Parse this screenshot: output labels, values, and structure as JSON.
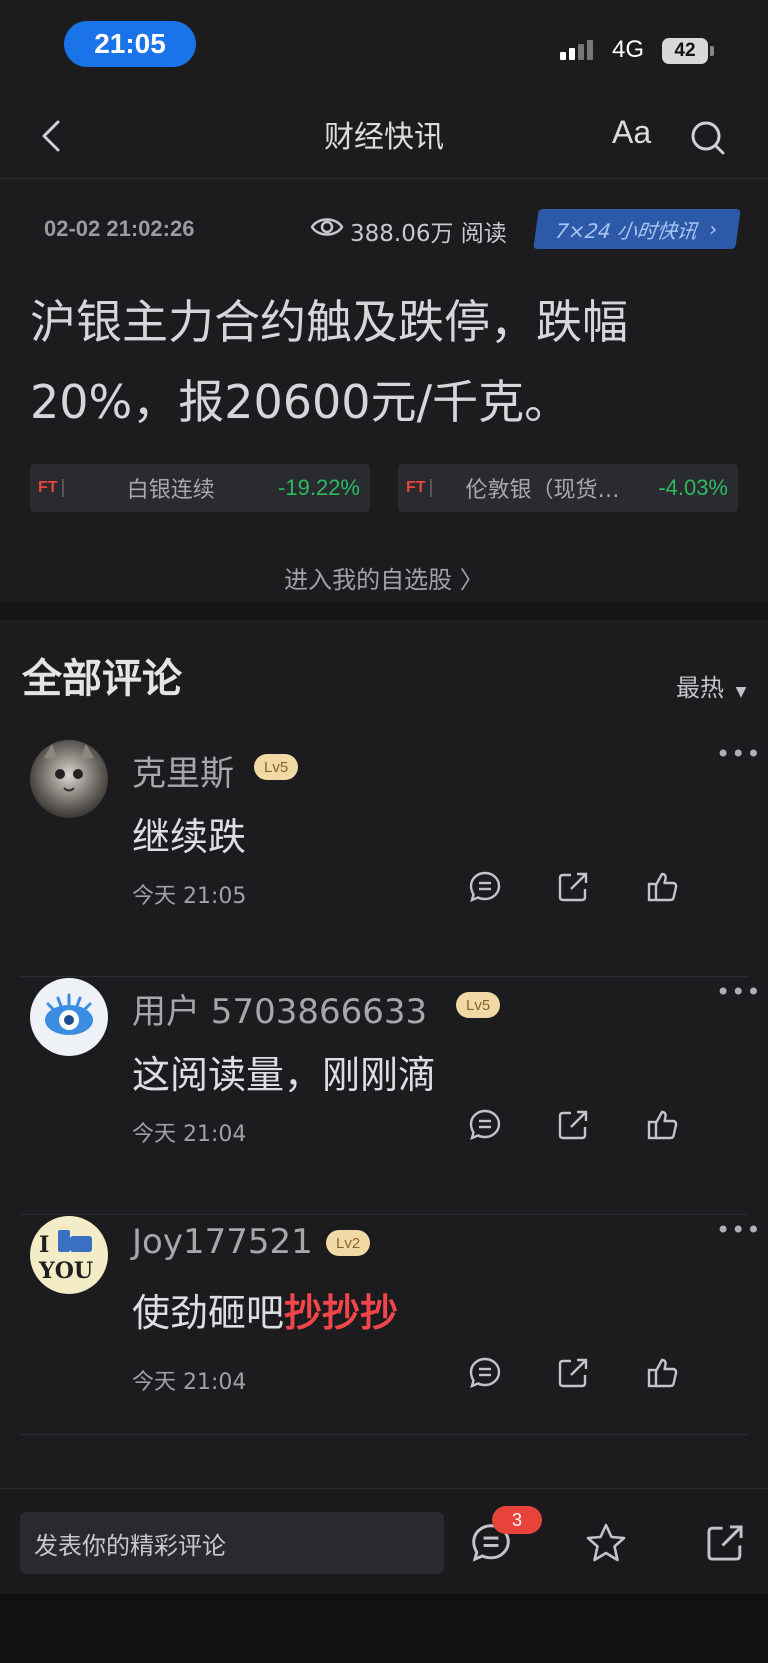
{
  "status_bar": {
    "time": "21:05",
    "network": "4G",
    "battery": "42"
  },
  "nav": {
    "title": "财经快讯",
    "font_label": "Aa"
  },
  "news": {
    "datetime": "02-02 21:02:26",
    "views": "388.06万 阅读",
    "tag": "7×24 小时快讯",
    "headline": "沪银主力合约触及跌停，跌幅20%，报20600元/千克。",
    "stocks": [
      {
        "badge": "FT",
        "name": "白银连续",
        "change": "-19.22%"
      },
      {
        "badge": "FT",
        "name": "伦敦银（现货…",
        "change": "-4.03%"
      }
    ],
    "watchlist_link": "进入我的自选股 〉"
  },
  "comments_section": {
    "title": "全部评论",
    "sort": "最热",
    "items": [
      {
        "user": "克里斯",
        "level": "Lv5",
        "text": "继续跌",
        "highlight": "",
        "time": "今天 21:05",
        "avatar": "cat-photo"
      },
      {
        "user": "用户 5703866633",
        "level": "Lv5",
        "text": "这阅读量，刚刚滴",
        "highlight": "",
        "time": "今天 21:04",
        "avatar": "weibo-eye"
      },
      {
        "user": "Joy177521",
        "level": "Lv2",
        "text": "使劲砸吧",
        "highlight": "抄抄抄",
        "time": "今天 21:04",
        "avatar": "i-like-you"
      }
    ]
  },
  "bottom_bar": {
    "placeholder": "发表你的精彩评论",
    "comment_count": "3"
  },
  "colors": {
    "accent_blue": "#1a73e8",
    "down_green": "#2bbb5e",
    "hot_red": "#f2464a",
    "level_badge": "#f1d9a6"
  }
}
